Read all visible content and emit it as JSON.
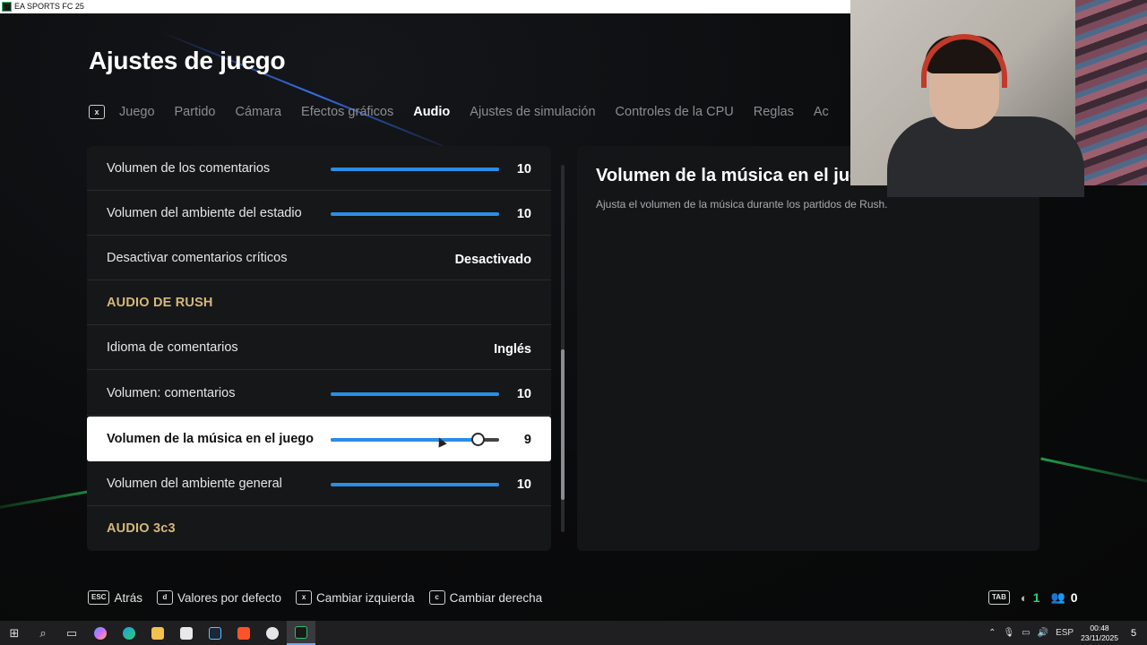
{
  "window": {
    "title": "EA SPORTS FC 25"
  },
  "header": {
    "title": "Ajustes de juego"
  },
  "tabs": {
    "key_left": "x",
    "items": [
      {
        "label": "Juego",
        "active": false
      },
      {
        "label": "Partido",
        "active": false
      },
      {
        "label": "Cámara",
        "active": false
      },
      {
        "label": "Efectos gráficos",
        "active": false
      },
      {
        "label": "Audio",
        "active": true
      },
      {
        "label": "Ajustes de simulación",
        "active": false
      },
      {
        "label": "Controles de la CPU",
        "active": false
      },
      {
        "label": "Reglas",
        "active": false
      },
      {
        "label": "Ac",
        "active": false
      }
    ]
  },
  "settings": [
    {
      "type": "slider",
      "label": "Volumen de los comentarios",
      "value": "10",
      "level": 10,
      "max": 10
    },
    {
      "type": "slider",
      "label": "Volumen del ambiente del estadio",
      "value": "10",
      "level": 10,
      "max": 10
    },
    {
      "type": "option",
      "label": "Desactivar comentarios críticos",
      "value": "Desactivado"
    },
    {
      "type": "section",
      "label": "AUDIO DE RUSH"
    },
    {
      "type": "option",
      "label": "Idioma de comentarios",
      "value": "Inglés"
    },
    {
      "type": "slider",
      "label": "Volumen: comentarios",
      "value": "10",
      "level": 10,
      "max": 10
    },
    {
      "type": "slider",
      "label": "Volumen de la música en el juego",
      "value": "9",
      "level": 9,
      "max": 10,
      "selected": true
    },
    {
      "type": "slider",
      "label": "Volumen del ambiente general",
      "value": "10",
      "level": 10,
      "max": 10
    },
    {
      "type": "section",
      "label": "AUDIO 3c3"
    }
  ],
  "detail": {
    "title": "Volumen de la música en el juego",
    "description": "Ajusta el volumen de la música durante los partidos de Rush."
  },
  "hints": [
    {
      "key": "ESC",
      "label": "Atrás"
    },
    {
      "key": "d",
      "label": "Valores por defecto"
    },
    {
      "key": "x",
      "label": "Cambiar izquierda"
    },
    {
      "key": "c",
      "label": "Cambiar derecha"
    }
  ],
  "hud": {
    "key": "TAB",
    "green_count": "1",
    "friends_count": "0"
  },
  "taskbar": {
    "apps": [
      "start-icon",
      "search-icon",
      "task-view-icon",
      "copilot-icon",
      "edge-icon",
      "folder-icon",
      "store-icon",
      "steam-icon",
      "brave-icon",
      "xbox-icon",
      "ea-fc-icon"
    ],
    "tray_lang": "ESP",
    "time": "00:48",
    "date": "23/11/2025",
    "notifications": "5"
  },
  "colors": {
    "accent_blue": "#2a8ee6",
    "section_gold": "#d4b87a",
    "hud_green": "#27d37a"
  }
}
